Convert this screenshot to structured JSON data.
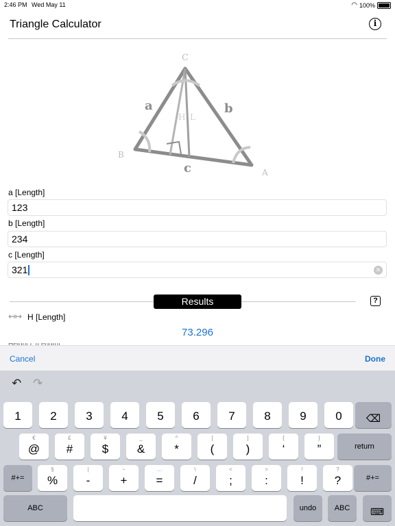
{
  "status": {
    "time": "2:46 PM",
    "date": "Wed May 11",
    "battery": "100%"
  },
  "header": {
    "title": "Triangle Calculator",
    "info_icon": "info-circle-icon"
  },
  "diagram": {
    "vertex_c": "C",
    "vertex_b": "B",
    "vertex_a": "A",
    "side_a": "a",
    "side_b": "b",
    "side_c": "c",
    "height_label": "H",
    "l_label": "L"
  },
  "inputs": [
    {
      "label": "a [Length]",
      "value": "123"
    },
    {
      "label": "b [Length]",
      "value": "234"
    },
    {
      "label": "c [Length]",
      "value": "321"
    }
  ],
  "results": {
    "title": "Results",
    "help": "?",
    "h_label": "H [Length]",
    "h_value": "73.296",
    "next_row_label": "Height L [Length]"
  },
  "accessory": {
    "cancel": "Cancel",
    "done": "Done"
  },
  "keyboard": {
    "row1": [
      {
        "main": "1"
      },
      {
        "main": "2"
      },
      {
        "main": "3"
      },
      {
        "main": "4"
      },
      {
        "main": "5"
      },
      {
        "main": "6"
      },
      {
        "main": "7"
      },
      {
        "main": "8"
      },
      {
        "main": "9"
      },
      {
        "main": "0"
      }
    ],
    "row2": [
      {
        "alt": "€",
        "main": "@"
      },
      {
        "alt": "£",
        "main": "#"
      },
      {
        "alt": "¥",
        "main": "$"
      },
      {
        "alt": "_",
        "main": "&"
      },
      {
        "alt": "^",
        "main": "*"
      },
      {
        "alt": "[",
        "main": "("
      },
      {
        "alt": "]",
        "main": ")"
      },
      {
        "alt": "{",
        "main": "‘"
      },
      {
        "alt": "}",
        "main": "”"
      }
    ],
    "row3": [
      {
        "alt": "§",
        "main": "%"
      },
      {
        "alt": "|",
        "main": "-"
      },
      {
        "alt": "~",
        "main": "+"
      },
      {
        "alt": "…",
        "main": "="
      },
      {
        "alt": "\\",
        "main": "/"
      },
      {
        "alt": "<",
        "main": ";"
      },
      {
        "alt": ">",
        "main": ":"
      },
      {
        "alt": "!",
        "main": "!"
      },
      {
        "alt": "?",
        "main": "?"
      }
    ],
    "return": "return",
    "symbols_left": "#+=",
    "symbols_right": "#+=",
    "abc_left": "ABC",
    "undo": "undo",
    "abc_right": "ABC"
  }
}
